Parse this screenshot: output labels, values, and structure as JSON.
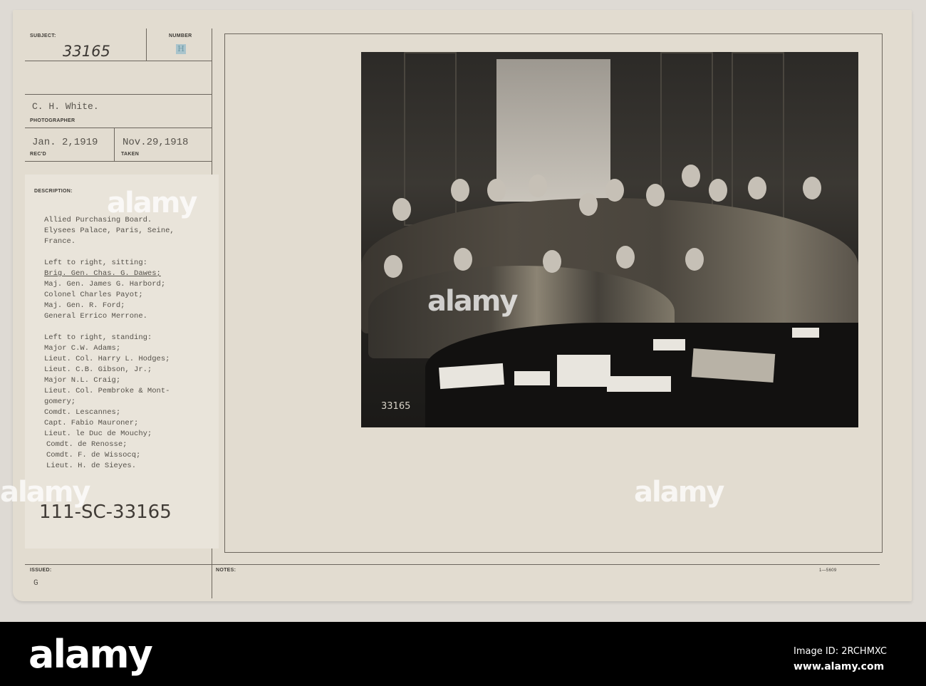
{
  "card": {
    "subject_label": "SUBJECT:",
    "subject_value": "33165",
    "number_label": "NUMBER",
    "number_stamp": "H",
    "photographer_value": "C. H. White.",
    "photographer_label": "PHOTOGRAPHER",
    "received_value": "Jan. 2,1919",
    "received_label": "REC'D",
    "taken_value": "Nov.29,1918",
    "taken_label": "TAKEN",
    "description_label": "DESCRIPTION:",
    "description_lines": [
      "Allied Purchasing Board.",
      "Elysees Palace, Paris, Seine,",
      "France.",
      "",
      "Left to right, sitting:",
      "Brig. Gen. Chas. G. Dawes;",
      "Maj. Gen. James G. Harbord;",
      "Colonel Charles Payot;",
      "Maj. Gen. R. Ford;",
      "General Errico Merrone.",
      "",
      "Left to right, standing:",
      "Major C.W. Adams;",
      "Lieut. Col. Harry L. Hodges;",
      "Lieut. C.B. Gibson, Jr.;",
      "Major N.L. Craig;",
      "Lieut. Col. Pembroke & Mont-",
      "gomery;",
      "Comdt. Lescannes;",
      "Capt. Fabio Mauroner;",
      "Lieut. le Duc de Mouchy;",
      "Comdt. de Renosse;",
      "Comdt. F. de Wissocq;",
      "Lieut. H. de Sieyes."
    ],
    "catalog_number": "111-SC-33165",
    "issued_label": "ISSUED:",
    "issued_value": "G",
    "notes_label": "NOTES:",
    "form_number": "1—5609",
    "photo_negative_number": "33165"
  },
  "watermark": {
    "text": "alamy",
    "image_id": "Image ID: 2RCHMXC",
    "url": "www.alamy.com"
  }
}
